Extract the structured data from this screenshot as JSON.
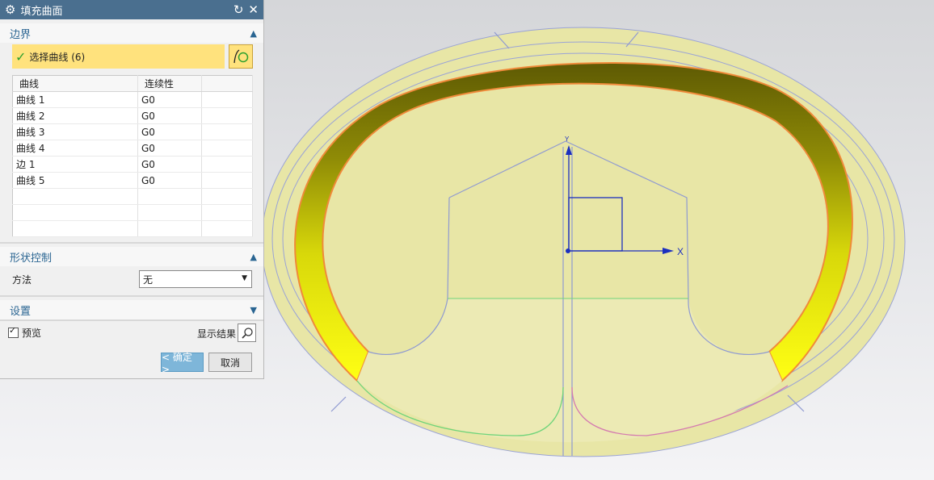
{
  "dialog": {
    "title": "填充曲面",
    "icons": {
      "gear": "gear-icon",
      "reset": "reset-icon",
      "close": "close-icon"
    },
    "boundary": {
      "header": "边界",
      "select_curve_label": "选择曲线 (6)",
      "table": {
        "columns": [
          "曲线",
          "连续性"
        ],
        "rows": [
          {
            "curve": "曲线 1",
            "continuity": "G0"
          },
          {
            "curve": "曲线 2",
            "continuity": "G0"
          },
          {
            "curve": "曲线 3",
            "continuity": "G0"
          },
          {
            "curve": "曲线 4",
            "continuity": "G0"
          },
          {
            "curve": "边 1",
            "continuity": "G0"
          },
          {
            "curve": "曲线 5",
            "continuity": "G0"
          }
        ]
      }
    },
    "shape_control": {
      "header": "形状控制",
      "method_label": "方法",
      "method_value": "无"
    },
    "settings": {
      "header": "设置"
    },
    "preview_label": "预览",
    "show_result_label": "显示结果",
    "ok_label": "< 确定 >",
    "cancel_label": "取消"
  },
  "viewport": {
    "axis_x_label": "X",
    "axis_y_label": "Y",
    "colors": {
      "ring": "#e8e6a6",
      "band_dark": "#6e6a05",
      "band_light": "#ffff14",
      "curve_blue": "#8f9ad1",
      "edge_orange": "#f08a3a",
      "green": "#6fd47a",
      "magenta": "#d47ab0"
    }
  }
}
